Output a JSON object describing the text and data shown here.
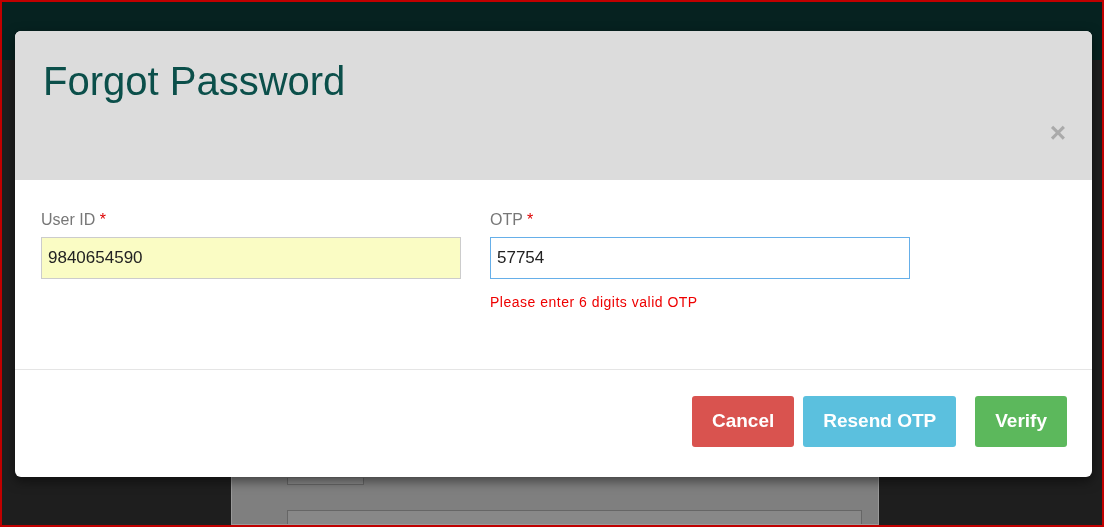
{
  "dialog": {
    "title": "Forgot Password",
    "close": "×"
  },
  "fields": [
    {
      "label": "User ID",
      "required": "*",
      "value": "9840654590",
      "autofilled": true,
      "focused": false
    },
    {
      "label": "OTP",
      "required": "*",
      "value": "57754",
      "autofilled": false,
      "focused": true,
      "error": "Please enter 6 digits valid OTP"
    }
  ],
  "buttons": [
    {
      "label": "Cancel",
      "kind": "danger"
    },
    {
      "label": "Resend OTP",
      "kind": "info"
    },
    {
      "label": "Verify",
      "kind": "success"
    }
  ]
}
